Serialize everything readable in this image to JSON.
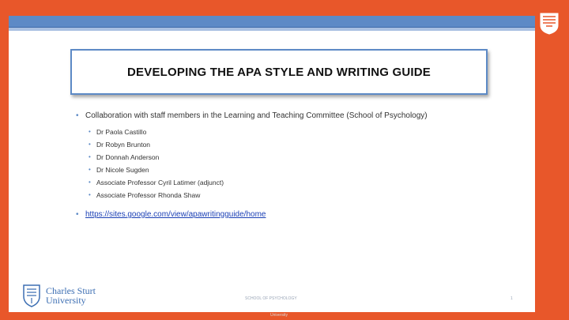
{
  "slide": {
    "title": "DEVELOPING  THE APA STYLE AND WRITING GUIDE",
    "main_bullet": "Collaboration with staff members in the Learning and Teaching Committee (School of Psychology)",
    "members": [
      "Dr Paola  Castillo",
      "Dr Robyn  Brunton",
      "Dr Donnah  Anderson",
      "Dr Nicole  Sugden",
      "Associate Professor Cyril Latimer (adjunct)",
      "Associate Professor Rhonda  Shaw"
    ],
    "link": "https://sites.google.com/view/apawritingguide/home"
  },
  "footer": {
    "logo_line1": "Charles Sturt",
    "logo_line2": "University",
    "center_text": "SCHOOL OF PSYCHOLOGY",
    "page_number": "1",
    "below_slide": "University"
  },
  "colors": {
    "background": "#e8572a",
    "accent_blue": "#5d8ac6",
    "link": "#1a3fb5"
  },
  "icons": [
    "csu-crest-icon",
    "csu-corner-logo-icon"
  ]
}
